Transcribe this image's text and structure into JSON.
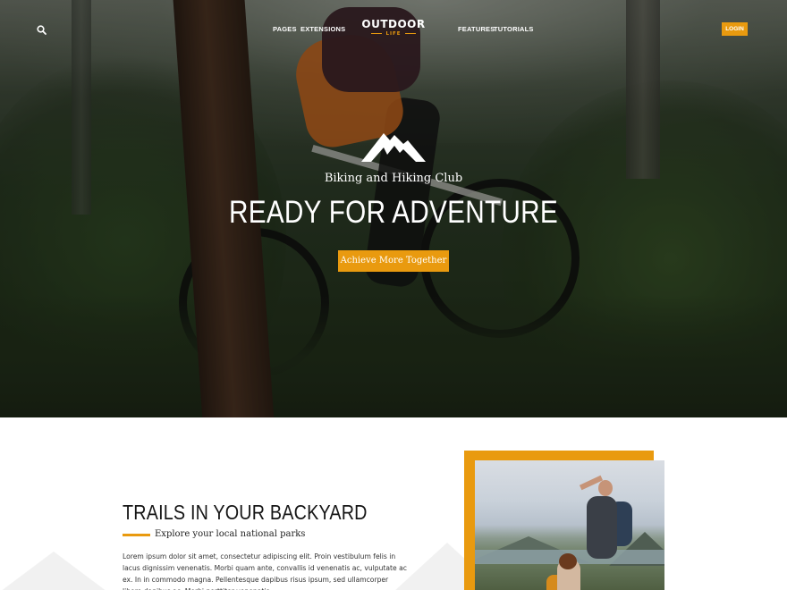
{
  "nav": {
    "links": [
      {
        "label": "PAGES"
      },
      {
        "label": "EXTENSIONS"
      },
      {
        "label": "FEATURES"
      },
      {
        "label": "TUTORIALS"
      }
    ],
    "logo": {
      "main": "OUTDOOR",
      "sub": "LIFE"
    },
    "login_label": "LOGIN"
  },
  "hero": {
    "subtitle": "Biking and Hiking Club",
    "title": "READY FOR ADVENTURE",
    "button_label": "Achieve More Together"
  },
  "section": {
    "title": "TRAILS IN YOUR BACKYARD",
    "subtitle": "Explore your local national parks",
    "body": "Lorem ipsum dolor sit amet, consectetur adipiscing elit. Proin vestibulum felis in lacus dignissim venenatis. Morbi quam ante, convallis id venenatis ac, vulputate ac ex. In in commodo magna. Pellentesque dapibus risus ipsum, sed ullamcorper libero dapibus ac. Morbi porttitor venenatis"
  },
  "colors": {
    "accent": "#e99a0f",
    "text_dark": "#151515",
    "white": "#ffffff"
  },
  "icons": {
    "search": "search-icon",
    "mountain": "mountain-icon"
  }
}
